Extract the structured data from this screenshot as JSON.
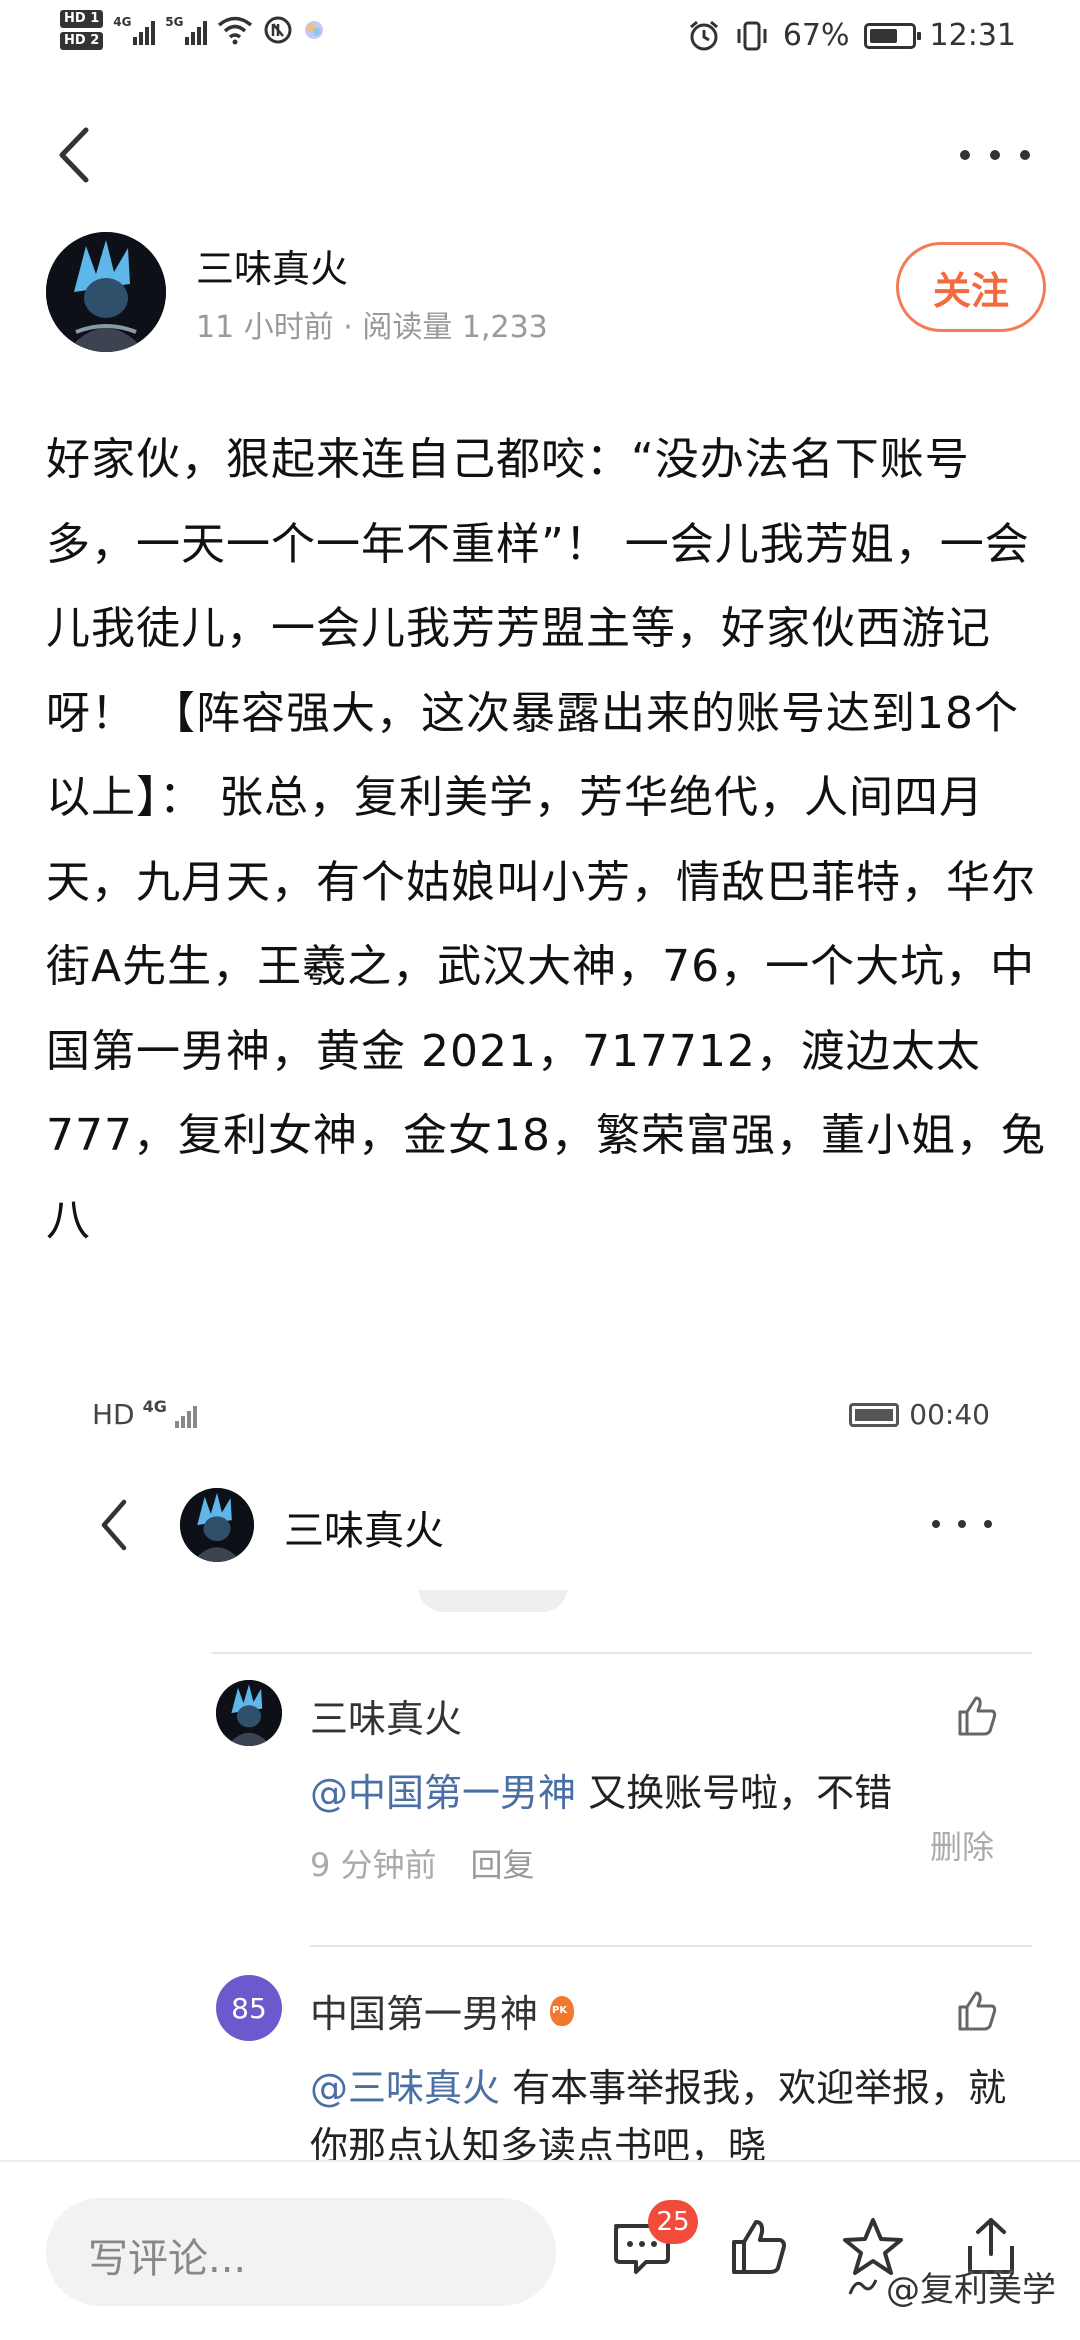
{
  "status_bar": {
    "hd1": "HD 1",
    "hd2": "HD 2",
    "sig1_gen": "4G",
    "sig2_gen": "5G",
    "battery_percent": "67%",
    "battery_level": 0.67,
    "time": "12:31"
  },
  "author": {
    "name": "三味真火",
    "meta": "11 小时前 · 阅读量 1,233",
    "follow_label": "关注"
  },
  "article": {
    "text": "好家伙，狠起来连自己都咬：“没办法名下账号多，一天一个一年不重样”！ 一会儿我芳姐，一会儿我徒儿，一会儿我芳芳盟主等，好家伙西游记呀！ 【阵容强大，这次暴露出来的账号达到18个以上】： 张总，复利美学，芳华绝代，人间四月天，九月天，有个姑娘叫小芳，情敌巴菲特，华尔街A先生，王羲之，武汉大神，76，一个大坑，中国第一男神，黄金 2021，717712，渡边太太777，复利女神，金女18，繁荣富强，董小姐，兔八"
  },
  "embedded": {
    "status": {
      "hd": "HD",
      "gen": "4G",
      "time": "00:40"
    },
    "nav_title": "三味真火",
    "comments": [
      {
        "author": "三味真火",
        "mention": "@中国第一男神",
        "text": " 又换账号啦，不错",
        "time": "9 分钟前",
        "reply_label": "回复",
        "delete_label": "删除"
      },
      {
        "author": "中国第一男神",
        "level": "85",
        "mention": "@三味真火",
        "text": " 有本事举报我，欢迎举报，就你那点认知多读点书吧，晓"
      }
    ]
  },
  "bottom_bar": {
    "comment_placeholder": "写评论...",
    "comment_count": "25",
    "watermark": "@复利美学"
  },
  "colors": {
    "accent": "#f26a3d",
    "mention": "#4a6fa5",
    "badge": "#f24a3b",
    "level_badge": "#6a5acd"
  },
  "icons": [
    "back-arrow-icon",
    "more-dots-icon",
    "thumb-up-icon",
    "comment-bubble-icon",
    "star-icon",
    "share-icon"
  ]
}
